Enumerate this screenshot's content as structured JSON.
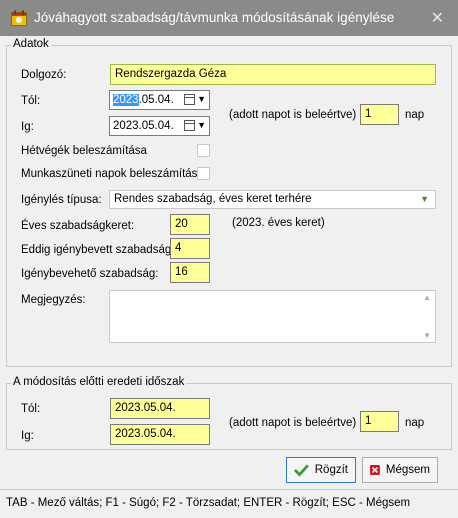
{
  "window": {
    "title": "Jóváhagyott szabadság/távmunka módosításának igénylése",
    "close_symbol": "✕"
  },
  "adatok": {
    "group_title": "Adatok",
    "dolgozo": {
      "label": "Dolgozó:",
      "value": "Rendszergazda Géza"
    },
    "tol": {
      "label": "Tól:",
      "year": "2023",
      "rest": ".05.04."
    },
    "ig": {
      "label": "Ig:",
      "value": "2023.05.04."
    },
    "adott_napot": "(adott napot is beleértve)",
    "nap_value": "1",
    "nap_label": "nap",
    "hetvegek": {
      "label": "Hétvégék beleszámítása",
      "checked": false
    },
    "munkaszuneti": {
      "label": "Munkaszüneti napok beleszámítása",
      "checked": false
    },
    "igenyles_tipusa": {
      "label": "Igénylés típusa:",
      "value": "Rendes szabadság, éves keret terhére"
    },
    "eves_keret": {
      "label": "Éves szabadságkeret:",
      "value": "20",
      "note": "(2023. éves keret)"
    },
    "eddig": {
      "label": "Eddig igénybevett szabadság:",
      "value": "4"
    },
    "igenybeveheto": {
      "label": "Igénybevehető szabadság:",
      "value": "16"
    },
    "megjegyzes": {
      "label": "Megjegyzés:",
      "value": ""
    }
  },
  "eredeti": {
    "group_title": "A módosítás előtti eredeti időszak",
    "tol": {
      "label": "Tól:",
      "value": "2023.05.04."
    },
    "ig": {
      "label": "Ig:",
      "value": "2023.05.04."
    },
    "adott_napot": "(adott napot is beleértve)",
    "nap_value": "1",
    "nap_label": "nap"
  },
  "buttons": {
    "save": "Rögzít",
    "cancel": "Mégsem"
  },
  "statusbar": "TAB - Mező váltás; F1 - Súgó; F2 - Törzsadat; ENTER - Rögzít; ESC - Mégsem",
  "colors": {
    "titlebar": "#8a8a8a",
    "field_yellow": "#ffff99",
    "selection": "#3399ff",
    "save_check": "#3a9a3a",
    "cancel_x": "#d01a1a"
  }
}
